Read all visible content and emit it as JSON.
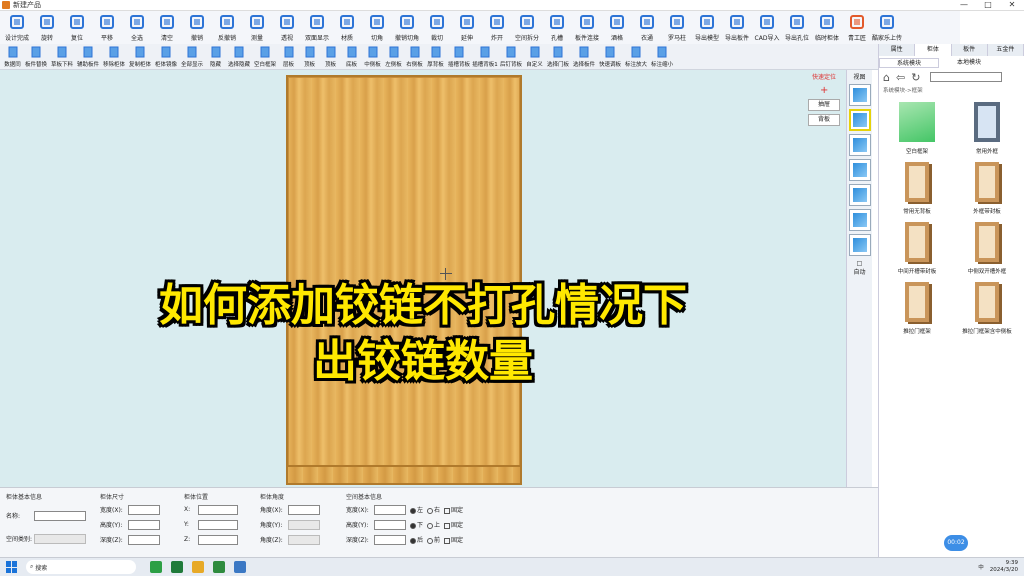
{
  "window": {
    "title": "新建产品",
    "controls": [
      "—",
      "□",
      "✕"
    ]
  },
  "toolbar_main": [
    {
      "label": "设计完成",
      "icon": "save-icon",
      "color": "#2d74d6"
    },
    {
      "label": "旋转",
      "icon": "rotate-icon",
      "color": "#2d74d6"
    },
    {
      "label": "复位",
      "icon": "reset-icon",
      "color": "#2d74d6"
    },
    {
      "label": "平移",
      "icon": "hand-icon",
      "color": "#2d74d6"
    },
    {
      "label": "全选",
      "icon": "select-all-icon",
      "color": "#2d74d6"
    },
    {
      "label": "清空",
      "icon": "trash-icon",
      "color": "#2d74d6"
    },
    {
      "label": "撤销",
      "icon": "undo-icon",
      "color": "#2d74d6"
    },
    {
      "label": "反撤销",
      "icon": "redo-icon",
      "color": "#2d74d6"
    },
    {
      "label": "测量",
      "icon": "measure-icon",
      "color": "#2d74d6"
    },
    {
      "label": "透视",
      "icon": "perspective-icon",
      "color": "#2d74d6"
    },
    {
      "label": "双面显示",
      "icon": "double-face-icon",
      "color": "#2d74d6"
    },
    {
      "label": "材质",
      "icon": "material-icon",
      "color": "#2d74d6"
    },
    {
      "label": "切角",
      "icon": "chamfer-icon",
      "color": "#2d74d6"
    },
    {
      "label": "撤销切角",
      "icon": "undo-chamfer-icon",
      "color": "#2d74d6"
    },
    {
      "label": "裁切",
      "icon": "cut-icon",
      "color": "#2d74d6"
    },
    {
      "label": "延伸",
      "icon": "extend-icon",
      "color": "#2d74d6"
    },
    {
      "label": "炸开",
      "icon": "explode-icon",
      "color": "#2d74d6"
    },
    {
      "label": "空间拆分",
      "icon": "split-space-icon",
      "color": "#2d74d6"
    },
    {
      "label": "孔槽",
      "icon": "hole-icon",
      "color": "#2d74d6"
    },
    {
      "label": "板件连接",
      "icon": "link-icon",
      "color": "#2d74d6"
    },
    {
      "label": "酒格",
      "icon": "wine-rack-icon",
      "color": "#2d74d6"
    },
    {
      "label": "衣通",
      "icon": "rail-icon",
      "color": "#2d74d6"
    },
    {
      "label": "罗马柱",
      "icon": "column-icon",
      "color": "#2d74d6"
    },
    {
      "label": "导出模型",
      "icon": "export-model-icon",
      "color": "#2d74d6"
    },
    {
      "label": "导出板件",
      "icon": "cad-export-icon",
      "color": "#2d74d6"
    },
    {
      "label": "CAD导入",
      "icon": "cad-import-icon",
      "color": "#2d74d6"
    },
    {
      "label": "导出孔位",
      "icon": "pdf-icon",
      "color": "#2d74d6"
    },
    {
      "label": "临时柜体",
      "icon": "database-icon",
      "color": "#2d74d6"
    },
    {
      "label": "青工匠",
      "icon": "brand-icon",
      "color": "#e25a2b"
    },
    {
      "label": "酷家乐上传",
      "icon": "upload-icon",
      "color": "#2d74d6"
    }
  ],
  "toolbar_sub": [
    "数据同",
    "板件替换",
    "草板下料",
    "辅助板件",
    "移除柜体",
    "复制柜体",
    "柜体镜像",
    "全部显示",
    "隐藏",
    "选择隐藏",
    "空白框架",
    "层板",
    "顶板",
    "顶板",
    "底板",
    "中侧板",
    "左侧板",
    "右侧板",
    "厚背板",
    "插槽背板",
    "插槽背板1",
    "后钉背板",
    "自定义",
    "选择门板",
    "选择板件",
    "快速调板",
    "标注放大",
    "标注缩小"
  ],
  "canvas": {
    "locate_label": "快速定位",
    "btn_insert": "抽屉",
    "btn_back": "背板",
    "overlay_line1": "如何添加铰链不打孔情况下",
    "overlay_line2": "出铰链数量"
  },
  "view": {
    "header": "视图",
    "auto_label": "自动"
  },
  "panel": {
    "tabs": [
      "属性",
      "柜体",
      "板件",
      "五金件"
    ],
    "active_tab": 1,
    "subtabs": [
      "系统模块",
      "本地模块"
    ],
    "breadcrumb": "系统模块->框架",
    "items": [
      {
        "name": "空白框架",
        "thumb": "green"
      },
      {
        "name": "常用外框",
        "thumb": "dark"
      },
      {
        "name": "常用无背板",
        "thumb": "frame"
      },
      {
        "name": "外框带封板",
        "thumb": "frame"
      },
      {
        "name": "中间开槽带封板",
        "thumb": "frame"
      },
      {
        "name": "中侧双开槽外框",
        "thumb": "frame"
      },
      {
        "name": "推拉门框架",
        "thumb": "frame"
      },
      {
        "name": "推拉门框架含中侧板",
        "thumb": "frame"
      }
    ],
    "timer": "00:02"
  },
  "props": {
    "basic": {
      "title": "柜体基本信息",
      "name_label": "名称:",
      "space_label": "空间类别:"
    },
    "size": {
      "title": "柜体尺寸",
      "w": "宽度(X):",
      "h": "高度(Y):",
      "d": "深度(Z):"
    },
    "pos": {
      "title": "柜体位置",
      "x": "X:",
      "y": "Y:",
      "z": "Z:"
    },
    "angle": {
      "title": "柜体角度",
      "ax": "角度(X):",
      "ay": "角度(Y):",
      "az": "角度(Z):"
    },
    "space": {
      "title": "空间基本信息",
      "w": "宽度(X):",
      "h": "高度(Y):",
      "d": "深度(Z):",
      "r1": [
        "左",
        "右",
        "固定"
      ],
      "r2": [
        "下",
        "上",
        "固定"
      ],
      "r3": [
        "后",
        "前",
        "固定"
      ]
    }
  },
  "taskbar": {
    "search_placeholder": "搜索",
    "time": "9:39",
    "date": "2024/3/20",
    "lang": "中",
    "app_colors": [
      "#2c9f45",
      "#1f7a3a",
      "#e7a927",
      "#2e8b3e",
      "#3b78c4"
    ]
  }
}
